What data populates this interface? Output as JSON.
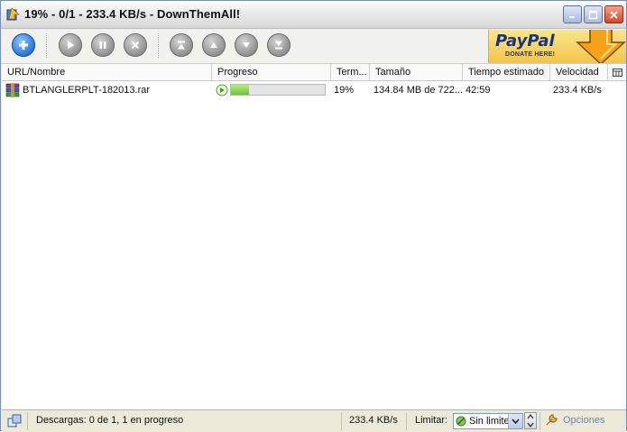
{
  "window": {
    "title": "19% - 0/1 - 233.4 KB/s - DownThemAll!"
  },
  "toolbar": {
    "buttons": [
      {
        "name": "add-button",
        "icon": "plus-icon"
      },
      {
        "name": "resume-button",
        "icon": "play-icon"
      },
      {
        "name": "pause-button",
        "icon": "pause-icon"
      },
      {
        "name": "cancel-button",
        "icon": "x-icon"
      },
      {
        "name": "move-top-button",
        "icon": "move-top-icon"
      },
      {
        "name": "move-up-button",
        "icon": "up-arrow-icon"
      },
      {
        "name": "move-down-button",
        "icon": "down-arrow-icon"
      },
      {
        "name": "move-bottom-button",
        "icon": "move-bottom-icon"
      }
    ],
    "paypal": {
      "brand": "PayPal",
      "tagline": "DONATE HERE!"
    }
  },
  "table": {
    "columns": [
      "URL/Nombre",
      "Progreso",
      "Term...",
      "Tamaño",
      "Tiempo estimado",
      "Velocidad"
    ],
    "rows": [
      {
        "name": "BTLANGLERPLT-182013.rar",
        "progress": 0.19,
        "percent": "19%",
        "size": "134.84 MB de 722...",
        "eta": "42:59",
        "speed": "233.4 KB/s"
      }
    ]
  },
  "statusbar": {
    "downloads": "Descargas: 0 de 1, 1 en progreso",
    "speed": "233.4 KB/s",
    "limit_label": "Limitar:",
    "limit_value": "Sin limite",
    "options_label": "Opciones"
  },
  "colors": {
    "accent_blue": "#2470d8",
    "progress_green": "#6cc23a",
    "close_red": "#d1472a",
    "paypal_yellow": "#f4c54a",
    "paypal_navy": "#18357c"
  }
}
